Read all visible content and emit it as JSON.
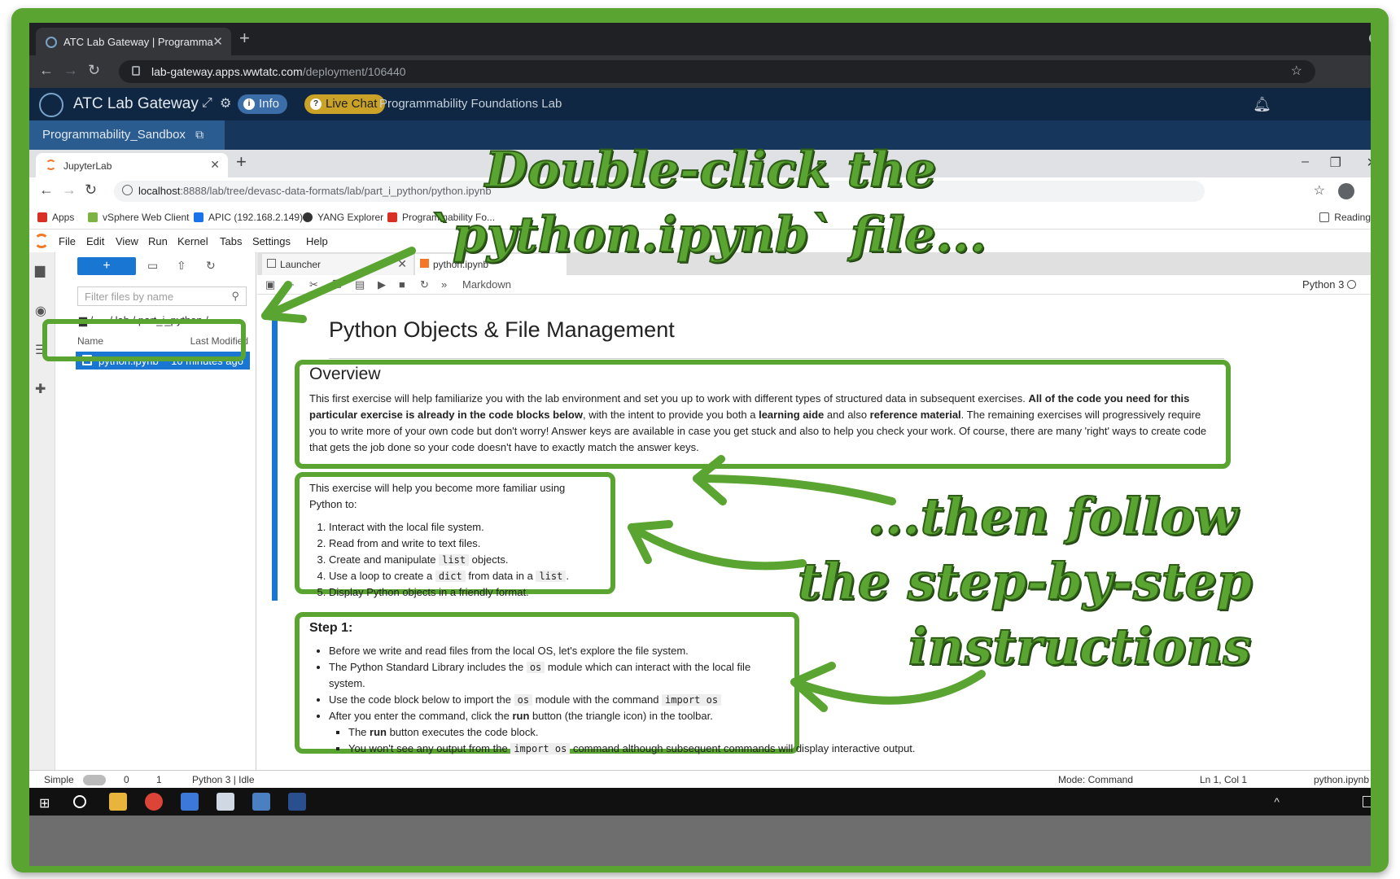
{
  "outer_browser": {
    "tab_title": "ATC Lab Gateway | Programma",
    "url_host": "lab-gateway.apps.wwtatc.com",
    "url_path": "/deployment/106440"
  },
  "gateway": {
    "title": "ATC Lab Gateway",
    "info_label": "Info",
    "chat_label": "Live Chat",
    "lab_name": "Programmability Foundations Lab",
    "sandbox_tab": "Programmability_Sandbox"
  },
  "inner_browser": {
    "tab_title": "JupyterLab",
    "url_host": "localhost",
    "url_rest": ":8888/lab/tree/devasc-data-formats/lab/part_i_python/python.ipynb",
    "bookmarks": [
      "Apps",
      "vSphere Web Client",
      "APIC (192.168.2.149)",
      "YANG Explorer",
      "Programmability Fo..."
    ],
    "reading_list": "Reading list"
  },
  "jupyter": {
    "menu": [
      "File",
      "Edit",
      "View",
      "Run",
      "Kernel",
      "Tabs",
      "Settings",
      "Help"
    ],
    "filter_placeholder": "Filter files by name",
    "breadcrumb": "/ ··· / lab / part_i_python /",
    "col_name": "Name",
    "col_modified": "Last Modified",
    "file_name": "python.ipynb",
    "file_modified": "10 minutes ago",
    "tab_launcher": "Launcher",
    "tab_notebook": "python.ipynb",
    "cell_type": "Markdown",
    "kernel": "Python 3",
    "notebook_title": "Python Objects & File Management"
  },
  "overview": {
    "heading": "Overview",
    "p1": "This first exercise will help familiarize you with the lab environment and set you up to work with different types of structured data in subsequent exercises. ",
    "b1": "All of the code you need for this particular exercise is already in the code blocks below",
    "p2": ", with the intent to provide you both a ",
    "b2": "learning aide",
    "p3": " and also ",
    "b3": "reference material",
    "p4": ". The remaining exercises will progressively require you to write more of your own code but don't worry! Answer keys are available in case you get stuck and also to help you check your work. Of course, there are many 'right' ways to create code that gets the job done so your code doesn't have to exactly match the answer keys."
  },
  "exercise": {
    "intro": "This exercise will help you become more familiar using Python to:",
    "i1": "Interact with the local file system.",
    "i2": "Read from and write to text files.",
    "i3a": "Create and manipulate ",
    "i3code": "list",
    "i3b": " objects.",
    "i4a": "Use a loop to create a ",
    "i4code1": "dict",
    "i4b": " from data in a ",
    "i4code2": "list",
    "i4c": ".",
    "i5": "Display Python objects in a friendly format."
  },
  "step1": {
    "heading": "Step 1:",
    "s1": "Before we write and read files from the local OS, let's explore the file system.",
    "s2a": "The Python Standard Library includes the ",
    "s2code": "os",
    "s2b": " module which can interact with the local file system.",
    "s3a": "Use the code block below to import the ",
    "s3code": "os",
    "s3b": " module with the command ",
    "s3code2": "import os",
    "s4a": "After you enter the command, click the ",
    "s4b": "run",
    "s4c": " button (the triangle icon) in the toolbar.",
    "s5a": "The ",
    "s5b": "run",
    "s5c": " button executes the code block.",
    "s6a": "You won't see any output from the ",
    "s6code": "import os",
    "s6b": " command although subsequent commands will display interactive output."
  },
  "statusbar": {
    "mode_simple": "Simple",
    "count0": "0",
    "count1": "1",
    "kernel_status": "Python 3 | Idle",
    "mode": "Mode: Command",
    "position": "Ln 1, Col 1",
    "file": "python.ipynb"
  },
  "annotations": {
    "line1": "Double-click the",
    "line2": "`python.ipynb` file...",
    "line3": "...then follow",
    "line4": "the step-by-step",
    "line5": "instructions"
  },
  "colors": {
    "highlight_green": "#5aa431",
    "jupyter_blue": "#1976d2",
    "gateway_navy": "#0f2743"
  }
}
